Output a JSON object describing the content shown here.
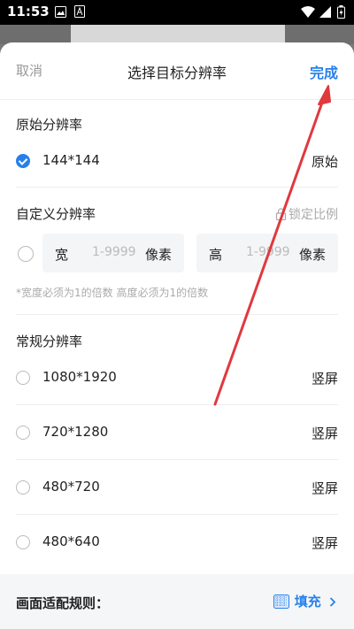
{
  "status": {
    "time": "11:53"
  },
  "header": {
    "cancel": "取消",
    "title": "选择目标分辨率",
    "done": "完成"
  },
  "original": {
    "title": "原始分辨率",
    "value": "144*144",
    "tag": "原始"
  },
  "custom": {
    "title": "自定义分辨率",
    "lock_label": "锁定比例",
    "width_label": "宽",
    "width_placeholder": "1-9999",
    "width_unit": "像素",
    "height_label": "高",
    "height_placeholder": "1-9999",
    "height_unit": "像素",
    "hint": "*宽度必须为1的倍数  高度必须为1的倍数"
  },
  "common": {
    "title": "常规分辨率",
    "items": [
      {
        "value": "1080*1920",
        "tag": "竖屏"
      },
      {
        "value": "720*1280",
        "tag": "竖屏"
      },
      {
        "value": "480*720",
        "tag": "竖屏"
      },
      {
        "value": "480*640",
        "tag": "竖屏"
      }
    ]
  },
  "footer": {
    "label": "画面适配规则：",
    "value": "填充"
  },
  "colors": {
    "accent": "#2680eb",
    "annotation_arrow": "#e0393e"
  }
}
